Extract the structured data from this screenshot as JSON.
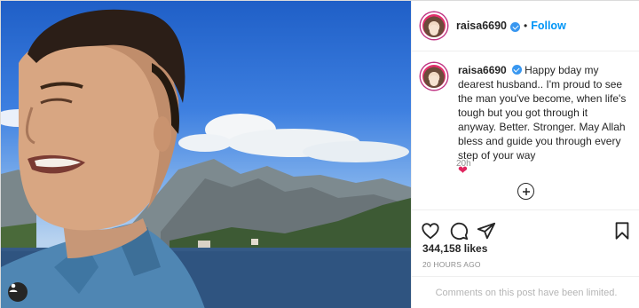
{
  "post": {
    "username": "raisa6690",
    "follow_label": "Follow",
    "separator": "•",
    "caption_text": "Happy bday my dearest husband.. I'm proud to see the man you've become, when life's tough but you got through it anyway. Better. Stronger. May Allah bless and guide you through every step of your way",
    "caption_emoji": "❤",
    "time_ago": "20h",
    "likes": "344,158 likes",
    "posted_ago": "20 HOURS AGO",
    "comments_disabled": "Comments on this post have been limited."
  },
  "icons": {
    "verified": "verified-badge",
    "like": "heart-icon",
    "comment": "comment-icon",
    "share": "share-icon",
    "save": "bookmark-icon",
    "load_more": "plus-circle-icon",
    "user_tag": "person-icon"
  },
  "colors": {
    "link": "#0095f6",
    "verified": "#3897f0",
    "muted": "#8e8e8e",
    "text": "#262626"
  }
}
